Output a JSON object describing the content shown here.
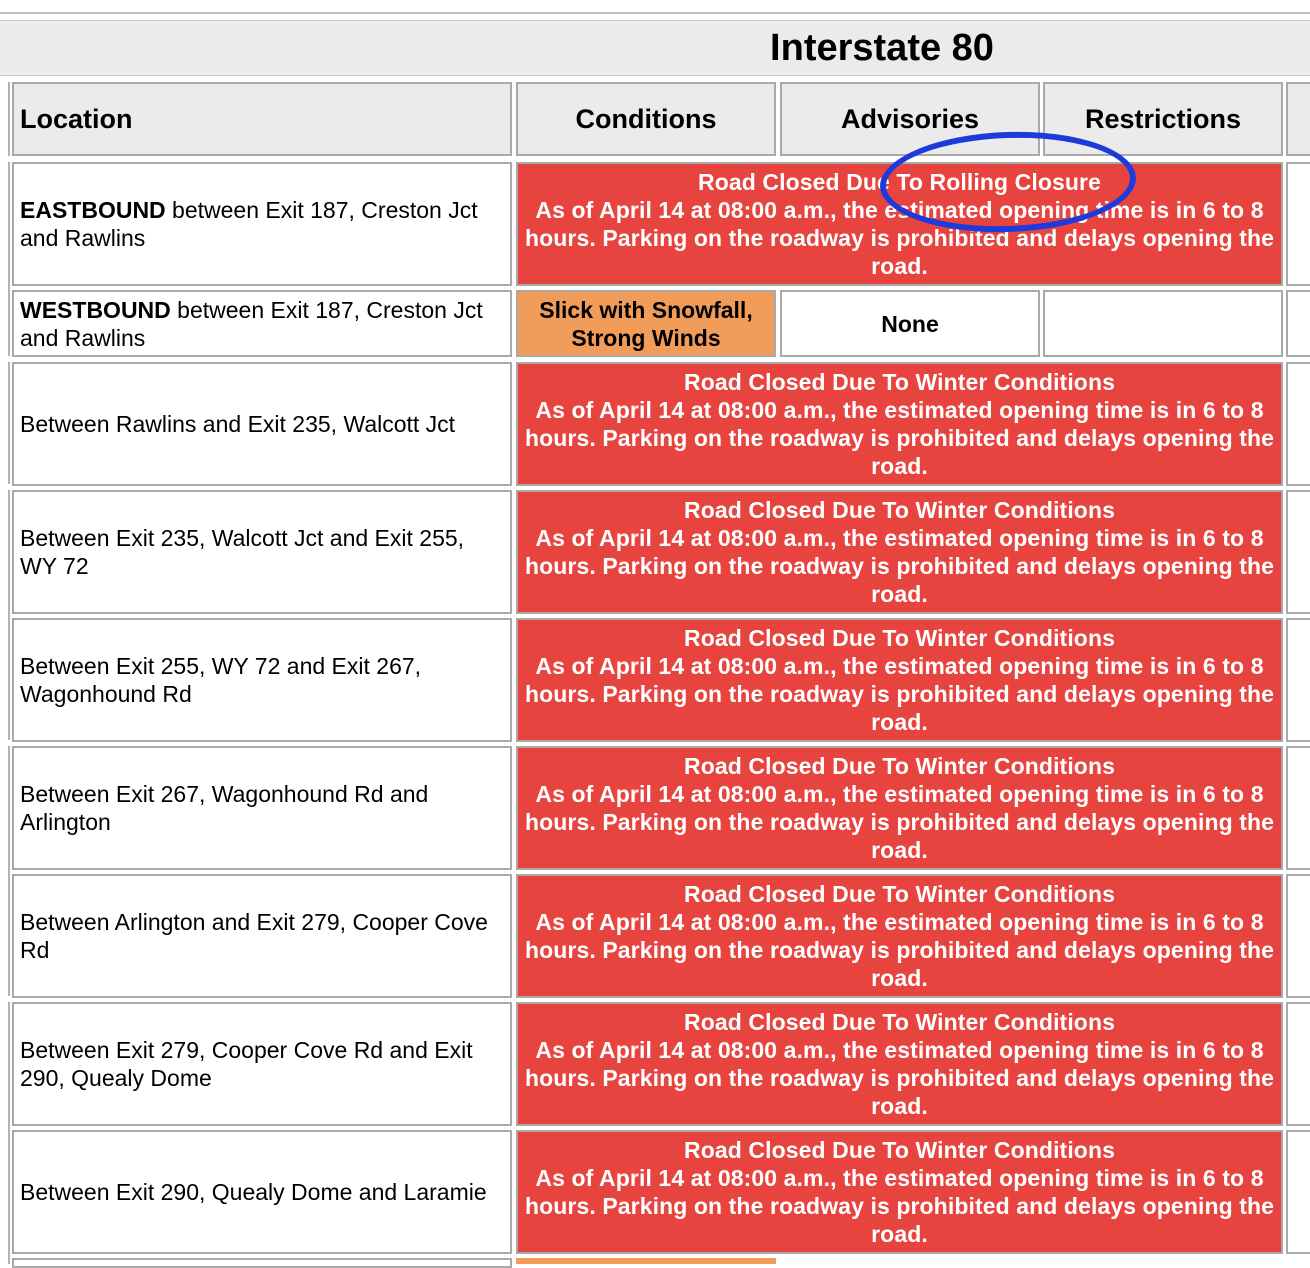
{
  "title": "Interstate 80",
  "headers": {
    "location": "Location",
    "conditions": "Conditions",
    "advisories": "Advisories",
    "restrictions": "Restrictions"
  },
  "rows": [
    {
      "loc_bold": "EASTBOUND",
      "loc_rest": " between Exit 187, Creston Jct and Rawlins",
      "status_title": "Road Closed Due To Rolling Closure",
      "status_detail": "As of April 14 at 08:00 a.m., the estimated opening time is in 6 to 8 hours. Parking on the roadway is prohibited and delays opening the road."
    },
    {
      "loc_bold": "WESTBOUND",
      "loc_rest": " between Exit 187, Creston Jct and Rawlins",
      "conditions": "Slick with Snowfall, Strong Winds",
      "advisories": "None",
      "restrictions": ""
    },
    {
      "location": "Between Rawlins and Exit 235, Walcott Jct",
      "status_title": "Road Closed Due To Winter Conditions",
      "status_detail": "As of April 14 at 08:00 a.m., the estimated opening time is in 6 to 8 hours. Parking on the roadway is prohibited and delays opening the road."
    },
    {
      "location": "Between Exit 235, Walcott Jct and Exit 255, WY 72",
      "status_title": "Road Closed Due To Winter Conditions",
      "status_detail": "As of April 14 at 08:00 a.m., the estimated opening time is in 6 to 8 hours. Parking on the roadway is prohibited and delays opening the road."
    },
    {
      "location": "Between Exit 255, WY 72 and Exit 267, Wagonhound Rd",
      "status_title": "Road Closed Due To Winter Conditions",
      "status_detail": "As of April 14 at 08:00 a.m., the estimated opening time is in 6 to 8 hours. Parking on the roadway is prohibited and delays opening the road."
    },
    {
      "location": "Between Exit 267, Wagonhound Rd and Arlington",
      "status_title": "Road Closed Due To Winter Conditions",
      "status_detail": "As of April 14 at 08:00 a.m., the estimated opening time is in 6 to 8 hours. Parking on the roadway is prohibited and delays opening the road."
    },
    {
      "location": "Between Arlington and Exit 279, Cooper Cove Rd",
      "status_title": "Road Closed Due To Winter Conditions",
      "status_detail": "As of April 14 at 08:00 a.m., the estimated opening time is in 6 to 8 hours. Parking on the roadway is prohibited and delays opening the road."
    },
    {
      "location": "Between Exit 279, Cooper Cove Rd and Exit 290, Quealy Dome",
      "status_title": "Road Closed Due To Winter Conditions",
      "status_detail": "As of April 14 at 08:00 a.m., the estimated opening time is in 6 to 8 hours. Parking on the roadway is prohibited and delays opening the road."
    },
    {
      "location": "Between Exit 290, Quealy Dome and Laramie",
      "status_title": "Road Closed Due To Winter Conditions",
      "status_detail": "As of April 14 at 08:00 a.m., the estimated opening time is in 6 to 8 hours. Parking on the roadway is prohibited and delays opening the road."
    }
  ],
  "colors": {
    "closed": "#e8443f",
    "caution": "#f29c5a",
    "header_bg": "#ebebeb",
    "annotation": "#1d3bdc"
  }
}
